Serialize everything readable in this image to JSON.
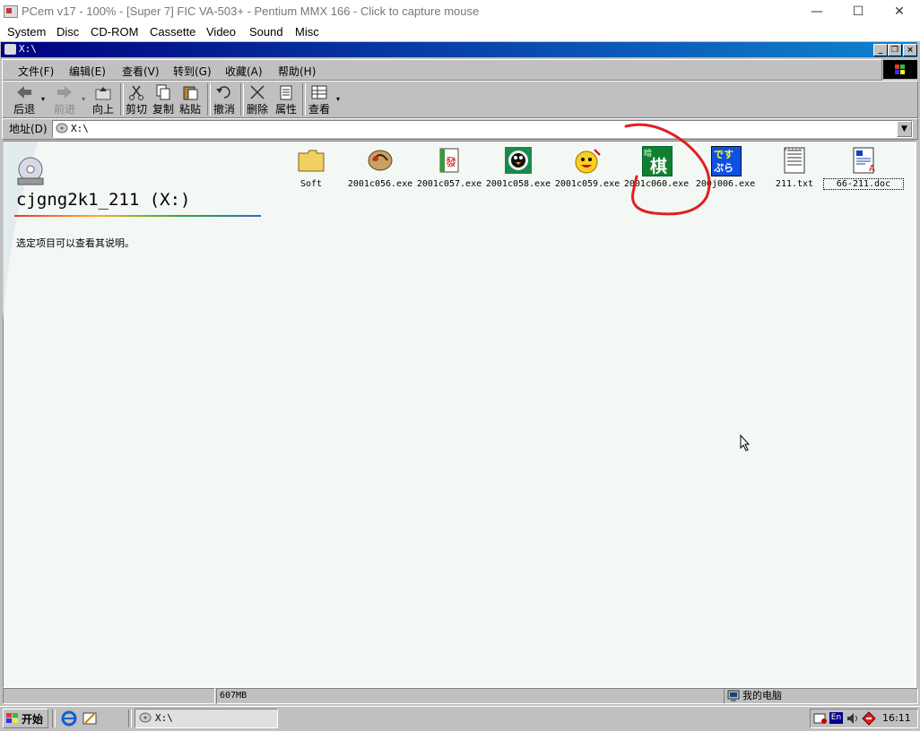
{
  "host": {
    "title": "PCem v17 - 100% - [Super 7] FIC VA-503+ - Pentium MMX 166 - Click to capture mouse",
    "menu": [
      "System",
      "Disc",
      "CD-ROM",
      "Cassette",
      "Video",
      "Sound",
      "Misc"
    ],
    "controls": {
      "minimize": "—",
      "maximize": "☐",
      "close": "✕"
    }
  },
  "window": {
    "title": "X:\\",
    "menu": [
      "文件(F)",
      "编辑(E)",
      "查看(V)",
      "转到(G)",
      "收藏(A)",
      "帮助(H)"
    ],
    "toolbar": [
      {
        "label": "后退",
        "icon": "back-arrow-icon"
      },
      {
        "label": "前进",
        "icon": "forward-arrow-icon",
        "disabled": true
      },
      {
        "label": "向上",
        "icon": "up-folder-icon"
      },
      {
        "label": "剪切",
        "icon": "scissors-icon"
      },
      {
        "label": "复制",
        "icon": "copy-icon"
      },
      {
        "label": "粘贴",
        "icon": "paste-icon"
      },
      {
        "label": "撤消",
        "icon": "undo-icon"
      },
      {
        "label": "删除",
        "icon": "delete-x-icon"
      },
      {
        "label": "属性",
        "icon": "properties-icon"
      },
      {
        "label": "查看",
        "icon": "view-icon"
      }
    ],
    "address": {
      "label": "地址(D)",
      "value": "X:\\"
    },
    "panel": {
      "drive_title": "cjgng2k1_211 (X:)",
      "hint": "选定项目可以查看其说明。"
    },
    "files": [
      {
        "name": "Soft",
        "icon": "folder-icon"
      },
      {
        "name": "2001c056.exe",
        "icon": "shell-icon"
      },
      {
        "name": "2001c057.exe",
        "icon": "mahjong-icon"
      },
      {
        "name": "2001c058.exe",
        "icon": "penguin-icon"
      },
      {
        "name": "2001c059.exe",
        "icon": "smiley-icon"
      },
      {
        "name": "2001c060.exe",
        "icon": "chess-icon",
        "char_top": "暗",
        "char_main": "棋"
      },
      {
        "name": "200j006.exe",
        "icon": "desupura-icon",
        "char_top": "です",
        "char_main": "ぷら"
      },
      {
        "name": "211.txt",
        "icon": "text-file-icon"
      },
      {
        "name": "66-211.doc",
        "icon": "word-doc-icon"
      }
    ],
    "status": {
      "size": "607MB",
      "location": "我的电脑"
    }
  },
  "taskbar": {
    "start": "开始",
    "task": "X:\\",
    "clock": "16:11",
    "ime": "En"
  },
  "colors": {
    "titlebar": "#000080",
    "face": "#c0c0c0",
    "annotation": "#e02020"
  }
}
